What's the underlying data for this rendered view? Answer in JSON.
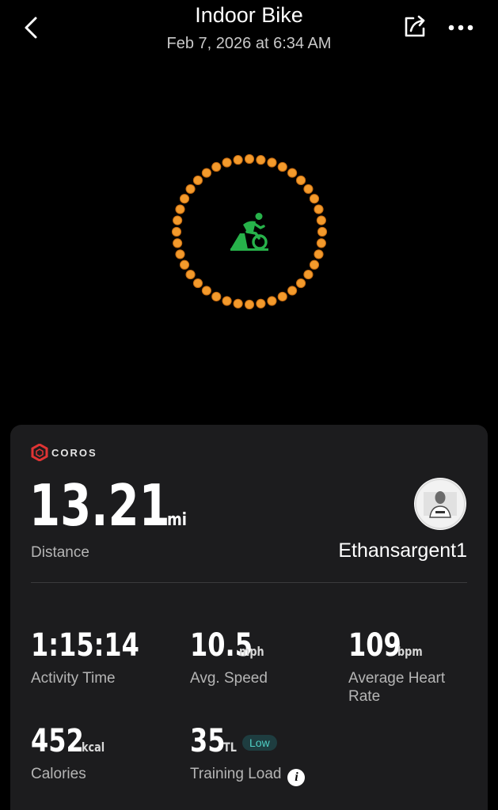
{
  "header": {
    "title": "Indoor Bike",
    "subtitle": "Feb 7, 2026 at 6:34 AM",
    "back_icon": "chevron-left-icon",
    "share_icon": "share-icon",
    "more_icon": "more-horizontal-icon"
  },
  "activity_ring": {
    "icon": "indoor-bike-icon",
    "dot_color": "#f39a2c",
    "icon_color": "#27b24a"
  },
  "card": {
    "brand": "COROS",
    "brand_color": "#e03434",
    "distance": {
      "value": "13.21",
      "unit": "mi",
      "label": "Distance"
    },
    "username": "Ethansargent1",
    "stats": [
      {
        "value": "1:15:14",
        "unit": "",
        "label": "Activity Time"
      },
      {
        "value": "10.5",
        "unit": "mph",
        "label": "Avg. Speed"
      },
      {
        "value": "109",
        "unit": "bpm",
        "label": "Average Heart Rate"
      },
      {
        "value": "452",
        "unit": "kcal",
        "label": "Calories"
      },
      {
        "value": "35",
        "unit": "TL",
        "label": "Training Load",
        "badge": "Low"
      }
    ]
  }
}
